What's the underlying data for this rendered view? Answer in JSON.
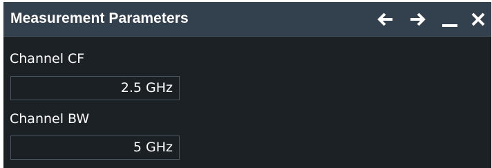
{
  "window": {
    "title": "Measurement Parameters"
  },
  "titlebar_icons": [
    "arrow-left-icon",
    "arrow-right-icon",
    "minimize-icon",
    "close-icon"
  ],
  "fields": [
    {
      "label": "Channel CF",
      "value": "2.5 GHz"
    },
    {
      "label": "Channel BW",
      "value": "5 GHz"
    }
  ],
  "colors": {
    "titlebar_bg": "#33404d",
    "dialog_bg": "#1c2126",
    "field_border": "#4a5560",
    "text": "#ffffff"
  }
}
